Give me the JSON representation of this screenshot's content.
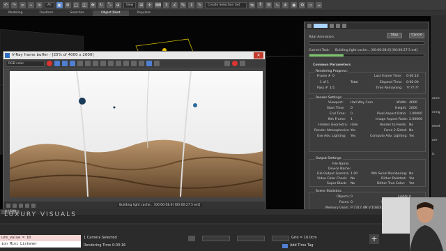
{
  "toolbar": {
    "selection_filter": "All",
    "view_dropdown": "View",
    "selection_set": "Create Selection Set"
  },
  "ribbon": {
    "tabs": [
      "Modeling",
      "Freeform",
      "Selection",
      "Object Paint",
      "Populate"
    ],
    "active": "Object Paint"
  },
  "vfb": {
    "title": "V-Ray frame buffer - [25% of 4000 x 2000]",
    "channel": "RGB color",
    "status_text": "Building light cache... [00:00:08.6] [00:00:27.5 est]"
  },
  "progress": {
    "title_label": "Rendering",
    "total_animation_label": "Total Animation:",
    "stop": "Stop",
    "cancel": "Cancel",
    "current_task_label": "Current Task:",
    "current_task": "Building light cache... [00:00:08.6] [00:00:27.5 est]",
    "current_task_pct": 0.3,
    "total_pct": 0.0,
    "common_params": "Common Parameters",
    "rendering_progress": "Rendering Progress:",
    "frame_label": "Frame #",
    "frame_value": "0",
    "of_label": "1  of  1",
    "total": "Total",
    "pass_label": "Pass #",
    "pass_value": "1/1",
    "last_frame_time_label": "Last Frame Time:",
    "last_frame_time": "0:00:16",
    "elapsed_label": "Elapsed Time:",
    "elapsed": "0:00:00",
    "remaining_label": "Time Remaining:",
    "remaining": "??:??:??",
    "render_settings": "Render Settings:",
    "viewport_label": "Viewport:",
    "viewport": "Hall Way Cam",
    "width_label": "Width:",
    "width": "4000",
    "start_label": "Start Time:",
    "start": "0",
    "height_label": "Height:",
    "height": "2000",
    "end_label": "End Time:",
    "end": "0",
    "pixel_aspect_label": "Pixel Aspect Ratio:",
    "pixel_aspect": "1.00000",
    "nth_label": "Nth Frame:",
    "nth": "1",
    "image_aspect_label": "Image Aspect Ratio:",
    "image_aspect": "2.00000",
    "hidden_geo_label": "Hidden Geometry:",
    "hidden_geo": "Hide",
    "render_fields_label": "Render to Fields:",
    "render_fields": "No",
    "render_atmos_label": "Render Atmospherics:",
    "render_atmos": "Yes",
    "force_2sided_label": "Force 2-Sided:",
    "force_2sided": "No",
    "use_adv_label": "Use Adv. Lighting:",
    "use_adv": "Yes",
    "compute_adv_label": "Compute Adv. Lighting:",
    "compute_adv": "Yes",
    "output_settings": "Output Settings:",
    "file_name_label": "File Name:",
    "device_name_label": "Device Name:",
    "gamma_label": "File Output Gamma:",
    "gamma": "1.00",
    "nth_serial_label": "Nth Serial Numbering:",
    "nth_serial": "No",
    "video_check_label": "Video Color Check:",
    "video_check": "No",
    "dither_pal_label": "Dither Paletted:",
    "dither_pal": "Yes",
    "super_black_label": "Super Black:",
    "super_black": "No",
    "dither_true_label": "Dither True Color:",
    "dither_true": "Yes",
    "scene_stats": "Scene Statistics:",
    "objects_label": "Objects:",
    "objects": "0",
    "lights_label": "Lights:",
    "lights": "0",
    "faces_label": "Faces:",
    "faces": "0",
    "shadow_label": "Shadow Mapped:",
    "shadow": "0",
    "memory_label": "Memory Used:",
    "memory": "P:7317.4M V:10824.8M",
    "ray_label": "Ray Traced:",
    "ray": "0"
  },
  "right_panel": {
    "labels": [
      "ance",
      "ering",
      "ment",
      "ure",
      "ic"
    ]
  },
  "bottom": {
    "watermark": "LUXURY VISUALS",
    "frame_counter": "0 / 100",
    "maxscript_line1": "ure_value = 10",
    "maxscript_line2": "ion Mini Listener",
    "camera_selected": "1 Camera Selected",
    "rendering_time": "Rendering Time  0:00:16",
    "grid": "Grid = 10.0cm",
    "add_time_tag": "Add Time Tag"
  },
  "colors": {
    "accent": "#5a86c8",
    "progress_green": "#7cc46a",
    "close_red": "#c0392b"
  }
}
